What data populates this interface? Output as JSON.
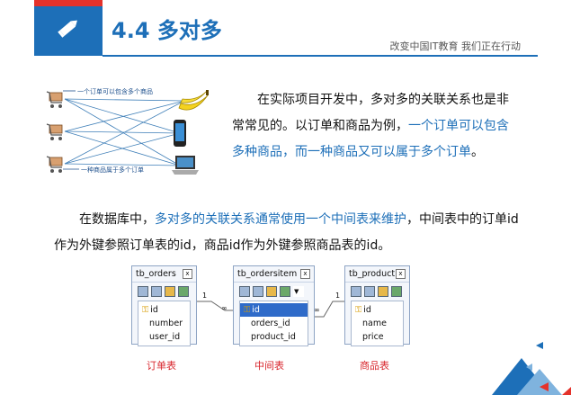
{
  "header": {
    "title": "4.4 多对多",
    "slogan": "改变中国IT教育 我们正在行动",
    "icon": "pencil-icon"
  },
  "illustration": {
    "annotation_top": "一个订单可以包含多个商品",
    "annotation_bottom": "一种商品属于多个订单",
    "left_icons": [
      "cart-icon",
      "cart-icon",
      "cart-icon"
    ],
    "right_icons": [
      "banana-icon",
      "phone-icon",
      "laptop-icon"
    ]
  },
  "para1": {
    "part1": "在实际项目开发中，多对多的关联关系也是非常常见的。以订单和商品为例，",
    "highlight": "一个订单可以包含多种商品，而一种商品又可以属于多个订单",
    "part2": "。"
  },
  "para2": {
    "part1": "在数据库中，",
    "highlight": "多对多的关联关系通常使用一个中间表来维护",
    "part2": "，中间表中的订单id作为外键参照订单表的id，商品id作为外键参照商品表的id。"
  },
  "diagram": {
    "tables": [
      {
        "name": "tb_orders",
        "fields": [
          "id",
          "number",
          "user_id"
        ],
        "caption": "订单表"
      },
      {
        "name": "tb_ordersitem",
        "fields": [
          "id",
          "orders_id",
          "product_id"
        ],
        "caption": "中间表"
      },
      {
        "name": "tb_product",
        "fields": [
          "id",
          "name",
          "price"
        ],
        "caption": "商品表"
      }
    ],
    "rel_one": "1",
    "rel_many": "∞"
  },
  "colors": {
    "brand_blue": "#1d6fb8",
    "accent_red": "#e4322b",
    "caption_red": "#d8262d"
  }
}
